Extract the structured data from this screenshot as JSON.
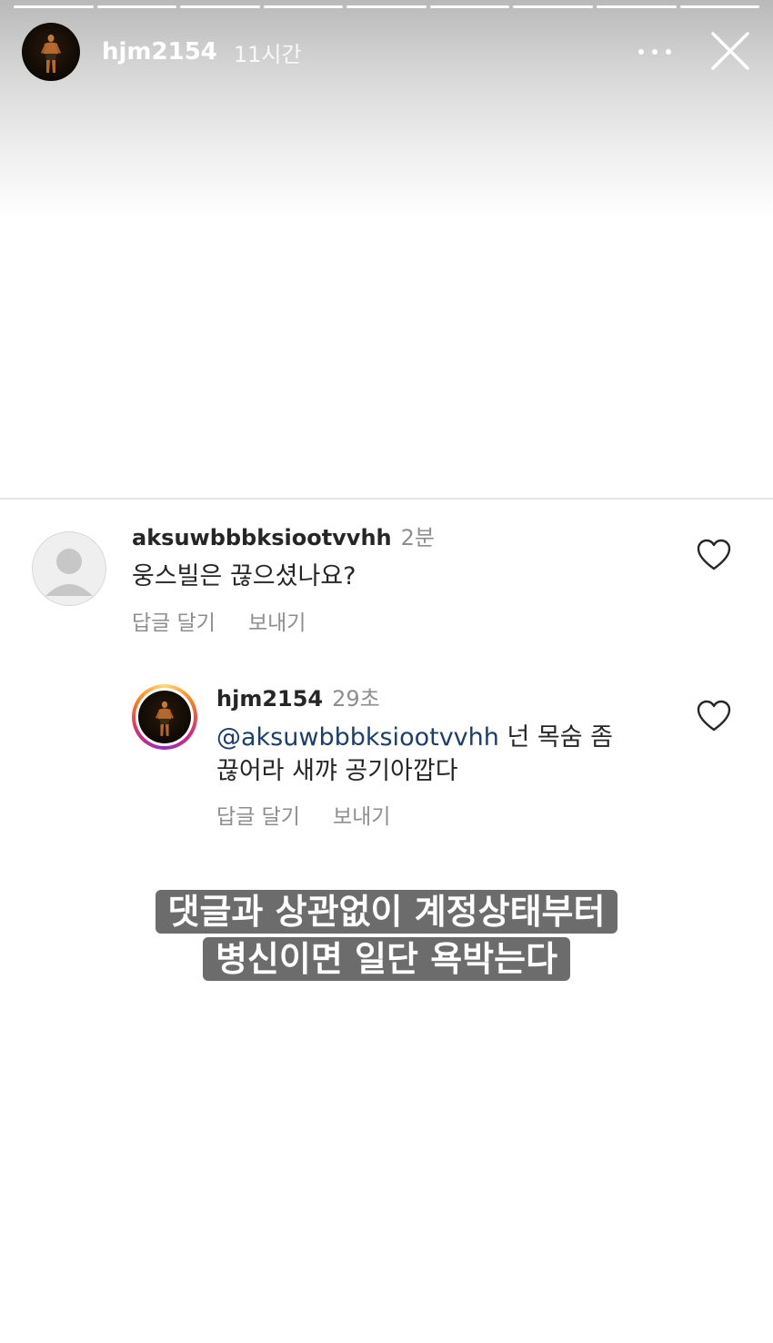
{
  "story": {
    "username": "hjm2154",
    "time": "11시간",
    "segments": 9
  },
  "comments": [
    {
      "username": "aksuwbbbksiootvvhh",
      "time": "2분",
      "text": "웅스빌은 끊으셨나요?",
      "reply_label": "답글 달기",
      "send_label": "보내기"
    },
    {
      "username": "hjm2154",
      "time": "29초",
      "mention": "@aksuwbbbksiootvvhh",
      "text_line1": " 넌 목숨 좀",
      "text_line2": "끊어라 새꺄 공기아깝다",
      "reply_label": "답글 달기",
      "send_label": "보내기"
    }
  ],
  "caption": {
    "line1": "댓글과 상관없이 계정상태부터",
    "line2": "병신이면 일단 욕박는다"
  },
  "icons": {
    "more": "more-dots-icon",
    "close": "close-icon",
    "like": "heart-icon",
    "default_avatar": "default-avatar-icon"
  },
  "colors": {
    "mention": "#1c3d6e",
    "muted": "#8e8e8e"
  }
}
